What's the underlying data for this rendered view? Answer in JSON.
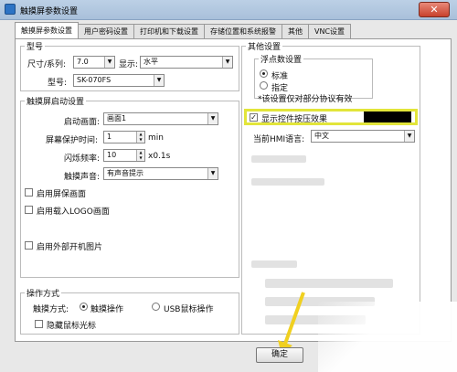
{
  "window": {
    "title": "触摸屏参数设置",
    "close_label": "✕"
  },
  "tabs": [
    "触摸屏参数设置",
    "用户密码设置",
    "打印机和下载设置",
    "存储位置和系统报警",
    "其他",
    "VNC设置"
  ],
  "model_group": {
    "legend": "型号",
    "size_label": "尺寸/系列:",
    "size_value": "7.0",
    "display_label": "显示:",
    "display_value": "水平",
    "model_label": "型号:",
    "model_value": "SK-070FS"
  },
  "startup_group": {
    "legend": "触摸屏启动设置",
    "start_screen_label": "启动画面:",
    "start_screen_value": "画面1",
    "screensaver_label": "屏幕保护时间:",
    "screensaver_value": "1",
    "screensaver_unit": "min",
    "blink_label": "闪烁频率:",
    "blink_value": "10",
    "blink_unit": "x0.1s",
    "sound_label": "触摸声音:",
    "sound_value": "有声音提示",
    "enable_saver": "启用屏保画面",
    "enable_logo": "启用载入LOGO画面",
    "enable_external": "启用外部开机图片"
  },
  "operation_group": {
    "legend": "操作方式",
    "mode_label": "触摸方式:",
    "touch_option": "触摸操作",
    "usb_option": "USB鼠标操作",
    "hide_cursor": "隐藏鼠标光标"
  },
  "other_group": {
    "legend": "其他设置",
    "float_legend": "浮点数设置",
    "standard": "标准",
    "specified": "指定",
    "note": "*该设置仅对部分协议有效",
    "press_effect": "显示控件按压效果",
    "press_effect_checked": "✓",
    "hmi_lang_label": "当前HMI语言:",
    "hmi_lang_value": "中文"
  },
  "footer": {
    "ok_label": "确定"
  },
  "colors": {
    "highlight": "#e2e53a",
    "arrow": "#f0d020"
  }
}
